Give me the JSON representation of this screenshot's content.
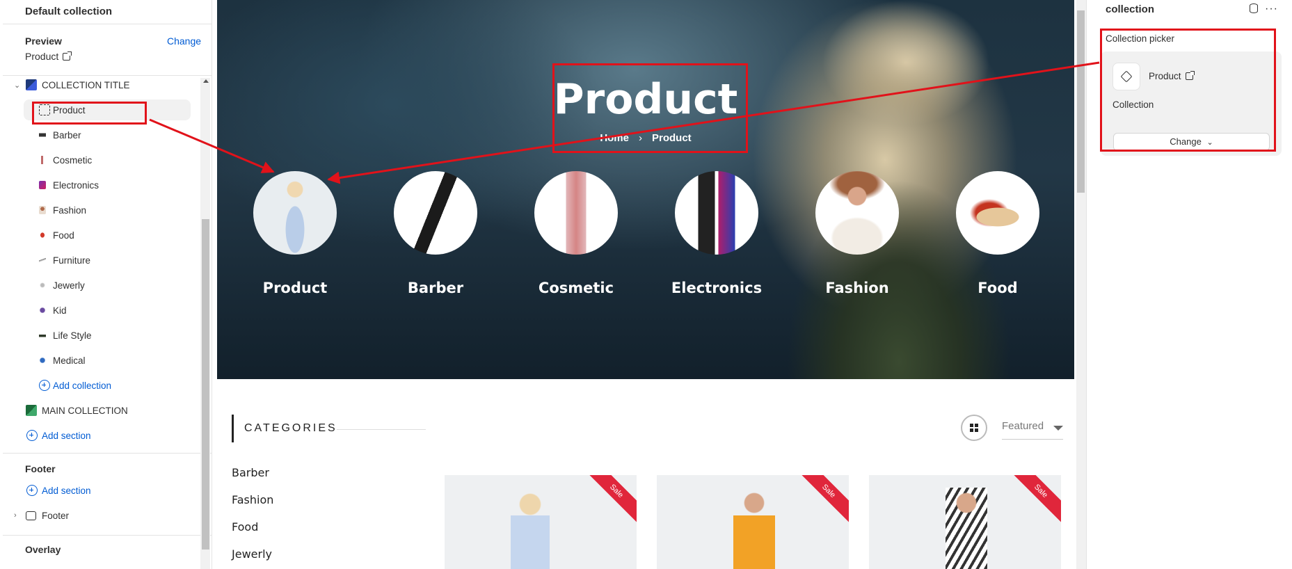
{
  "left_panel": {
    "section_title": "Default collection",
    "preview_label": "Preview",
    "change_label": "Change",
    "preview_value": "Product",
    "tree": [
      {
        "label": "COLLECTION TITLE",
        "icon": "section-icon"
      },
      {
        "label": "Product",
        "icon": "dashed-square-icon",
        "selected": true
      },
      {
        "label": "Barber",
        "icon": "barber-thumb"
      },
      {
        "label": "Cosmetic",
        "icon": "cosmetic-thumb"
      },
      {
        "label": "Electronics",
        "icon": "electronics-thumb"
      },
      {
        "label": "Fashion",
        "icon": "fashion-thumb"
      },
      {
        "label": "Food",
        "icon": "food-thumb"
      },
      {
        "label": "Furniture",
        "icon": "furniture-thumb"
      },
      {
        "label": "Jewerly",
        "icon": "jewerly-thumb"
      },
      {
        "label": "Kid",
        "icon": "kid-thumb"
      },
      {
        "label": "Life Style",
        "icon": "lifestyle-thumb"
      },
      {
        "label": "Medical",
        "icon": "medical-thumb"
      }
    ],
    "add_collection": "Add collection",
    "main_collection": "MAIN COLLECTION",
    "add_section": "Add section",
    "footer_title": "Footer",
    "footer_add_section": "Add section",
    "footer_item": "Footer",
    "overlay_title": "Overlay"
  },
  "preview": {
    "hero_title": "Product",
    "breadcrumb_home": "Home",
    "breadcrumb_sep": "›",
    "breadcrumb_current": "Product",
    "categories": [
      "Product",
      "Barber",
      "Cosmetic",
      "Electronics",
      "Fashion",
      "Food"
    ],
    "categories_heading": "CATEGORIES",
    "category_list": [
      "Barber",
      "Fashion",
      "Food",
      "Jewerly"
    ],
    "sort_label": "Featured",
    "sale_badge": "Sale"
  },
  "right_panel": {
    "title": "collection",
    "picker_label": "Collection picker",
    "selected_name": "Product",
    "selected_type": "Collection",
    "change_label": "Change"
  },
  "colors": {
    "accent": "#005bd3",
    "annotation": "#e1121a",
    "sale": "#e0263b"
  }
}
